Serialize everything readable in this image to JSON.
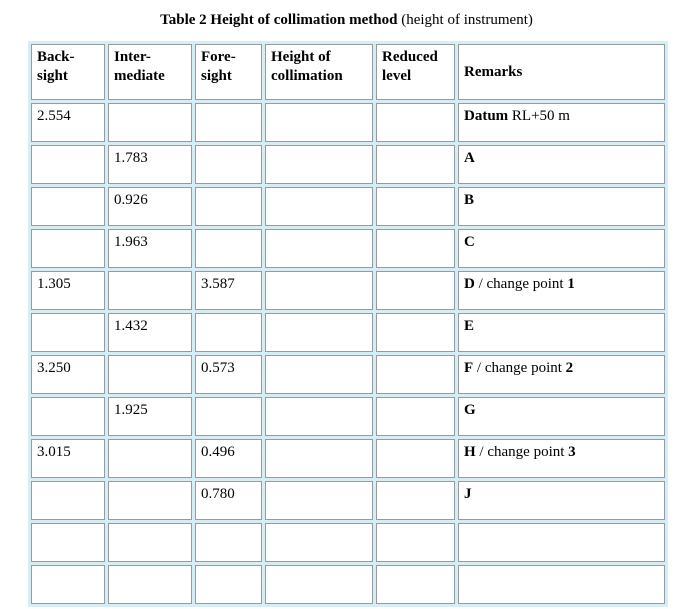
{
  "caption": {
    "main": "Table 2 Height of collimation method",
    "sub": "(height of instrument)"
  },
  "table": {
    "headers": [
      {
        "line1": "Back-",
        "line2": "sight"
      },
      {
        "line1": "Inter-",
        "line2": "mediate"
      },
      {
        "line1": "Fore-",
        "line2": "sight"
      },
      {
        "line1": "Height of",
        "line2": "collimation"
      },
      {
        "line1": "Reduced",
        "line2": "level"
      },
      {
        "line1": "Remarks",
        "line2": ""
      }
    ],
    "rows": [
      {
        "backsight": "2.554",
        "intermediate": "",
        "foresight": "",
        "collimation": "",
        "reduced": "",
        "remarks_station": "Datum",
        "remarks_note": " RL+50 m",
        "remarks_num": ""
      },
      {
        "backsight": "",
        "intermediate": "1.783",
        "foresight": "",
        "collimation": "",
        "reduced": "",
        "remarks_station": "A",
        "remarks_note": "",
        "remarks_num": ""
      },
      {
        "backsight": "",
        "intermediate": "0.926",
        "foresight": "",
        "collimation": "",
        "reduced": "",
        "remarks_station": "B",
        "remarks_note": "",
        "remarks_num": ""
      },
      {
        "backsight": "",
        "intermediate": "1.963",
        "foresight": "",
        "collimation": "",
        "reduced": "",
        "remarks_station": "C",
        "remarks_note": "",
        "remarks_num": ""
      },
      {
        "backsight": "1.305",
        "intermediate": "",
        "foresight": "3.587",
        "collimation": "",
        "reduced": "",
        "remarks_station": "D",
        "remarks_note": " / change point ",
        "remarks_num": "1"
      },
      {
        "backsight": "",
        "intermediate": "1.432",
        "foresight": "",
        "collimation": "",
        "reduced": "",
        "remarks_station": "E",
        "remarks_note": "",
        "remarks_num": ""
      },
      {
        "backsight": "3.250",
        "intermediate": "",
        "foresight": "0.573",
        "collimation": "",
        "reduced": "",
        "remarks_station": "F",
        "remarks_note": " / change point ",
        "remarks_num": "2"
      },
      {
        "backsight": "",
        "intermediate": "1.925",
        "foresight": "",
        "collimation": "",
        "reduced": "",
        "remarks_station": "G",
        "remarks_note": "",
        "remarks_num": ""
      },
      {
        "backsight": "3.015",
        "intermediate": "",
        "foresight": "0.496",
        "collimation": "",
        "reduced": "",
        "remarks_station": "H",
        "remarks_note": " / change point ",
        "remarks_num": "3"
      },
      {
        "backsight": "",
        "intermediate": "",
        "foresight": "0.780",
        "collimation": "",
        "reduced": "",
        "remarks_station": "J",
        "remarks_note": "",
        "remarks_num": ""
      },
      {
        "backsight": "",
        "intermediate": "",
        "foresight": "",
        "collimation": "",
        "reduced": "",
        "remarks_station": "",
        "remarks_note": "",
        "remarks_num": ""
      },
      {
        "backsight": "",
        "intermediate": "",
        "foresight": "",
        "collimation": "",
        "reduced": "",
        "remarks_station": "",
        "remarks_note": "",
        "remarks_num": ""
      }
    ]
  },
  "colors": {
    "border_band": "#d4eef7",
    "cell_border": "#9a9a9a",
    "text": "#000000",
    "background": "#ffffff"
  }
}
